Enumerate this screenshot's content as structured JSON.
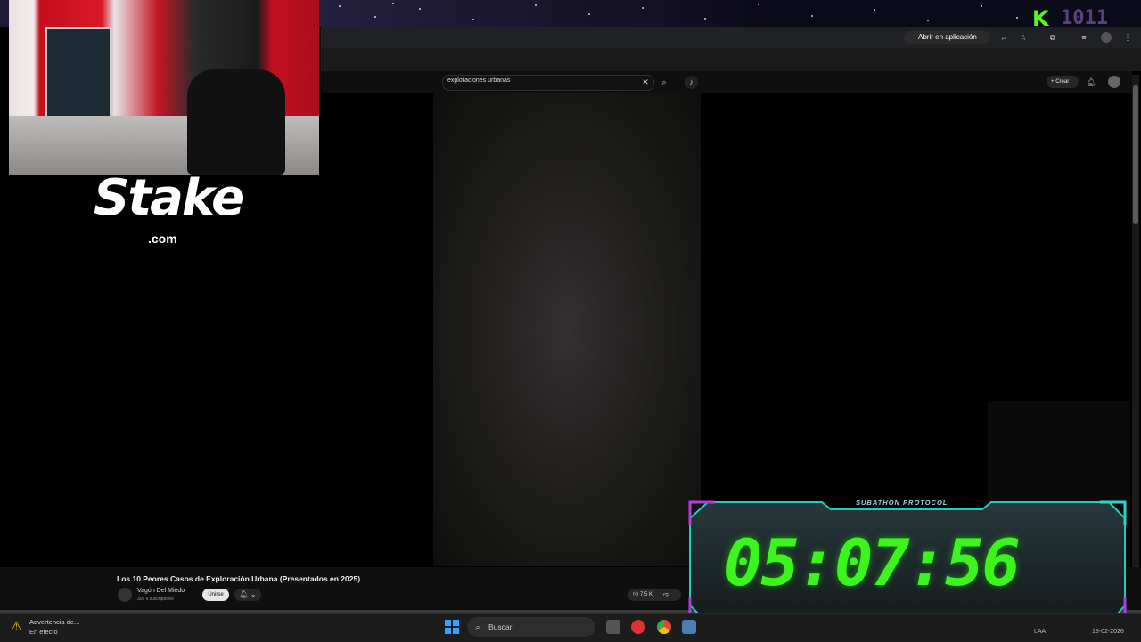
{
  "browser": {
    "open_in_app_label": "Abrir en aplicación"
  },
  "youtube": {
    "search_value": "exploraciones urbanas",
    "create_label": "Crear",
    "video": {
      "title": "Los 10 Peores Casos de Exploración Urbana (Presentados en 2025)",
      "channel": "Vagón Del Miedo",
      "subscribers": "309 k suscriptores",
      "join_label": "Unirse",
      "likes": "7.5 K"
    }
  },
  "overlay": {
    "sponsor_logo": "Stake",
    "sponsor_sub": ".com",
    "timer_label": "SUBATHON PROTOCOL",
    "timer_value": "05:07:56",
    "kick_count": "1011",
    "accent_color": "#3cf51e",
    "frame_color": "#26d6c8"
  },
  "taskbar": {
    "warning_title": "Advertencia de...",
    "warning_sub": "En efecto",
    "search_label": "Buscar",
    "language": "LAA",
    "date": "18-02-2026"
  }
}
